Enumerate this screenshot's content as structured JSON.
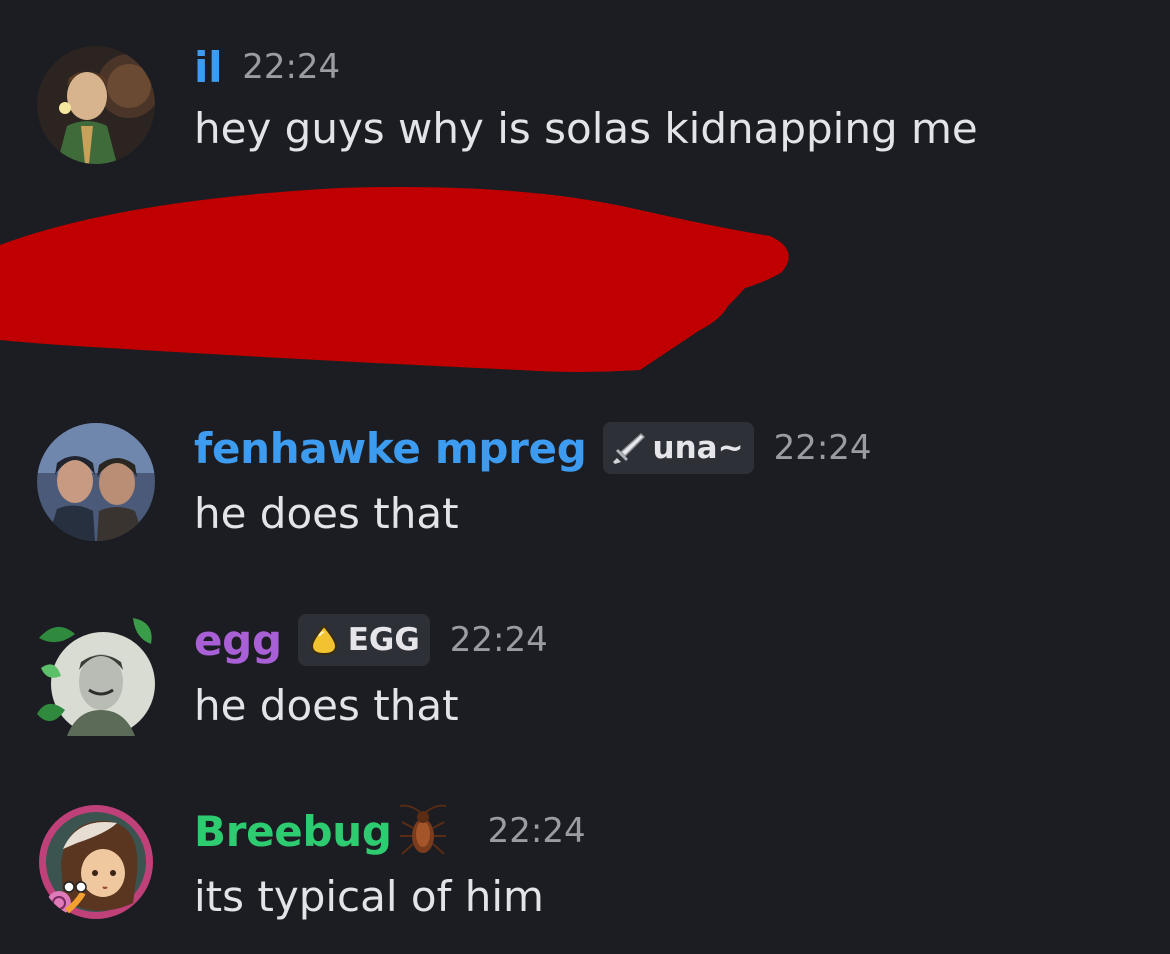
{
  "colors": {
    "background": "#1c1d22",
    "redaction": "#c00000",
    "text": "#e3e4e8",
    "timestamp": "#9a9ba3"
  },
  "messages": [
    {
      "username": "il",
      "username_color": "#3d9cf0",
      "timestamp": "22:24",
      "text": "hey guys why is solas kidnapping me",
      "avatar_icon": "elf-portrait-avatar"
    },
    {
      "username": "fenhawke mpreg",
      "username_color": "#3d9cf0",
      "role_tag": {
        "icon": "sword-icon",
        "label": "una~"
      },
      "timestamp": "22:24",
      "text": "he does that",
      "avatar_icon": "couple-portrait-avatar"
    },
    {
      "username": "egg",
      "username_color": "#a95fd6",
      "role_tag": {
        "icon": "egg-icon",
        "label": "EGG"
      },
      "timestamp": "22:24",
      "text": "he does that",
      "avatar_icon": "leafy-portrait-avatar"
    },
    {
      "username": "Breebug",
      "username_color": "#2ecc71",
      "name_emoji": "cockroach-icon",
      "timestamp": "22:24",
      "text": "its typical of him",
      "avatar_icon": "pixel-portrait-avatar"
    }
  ]
}
